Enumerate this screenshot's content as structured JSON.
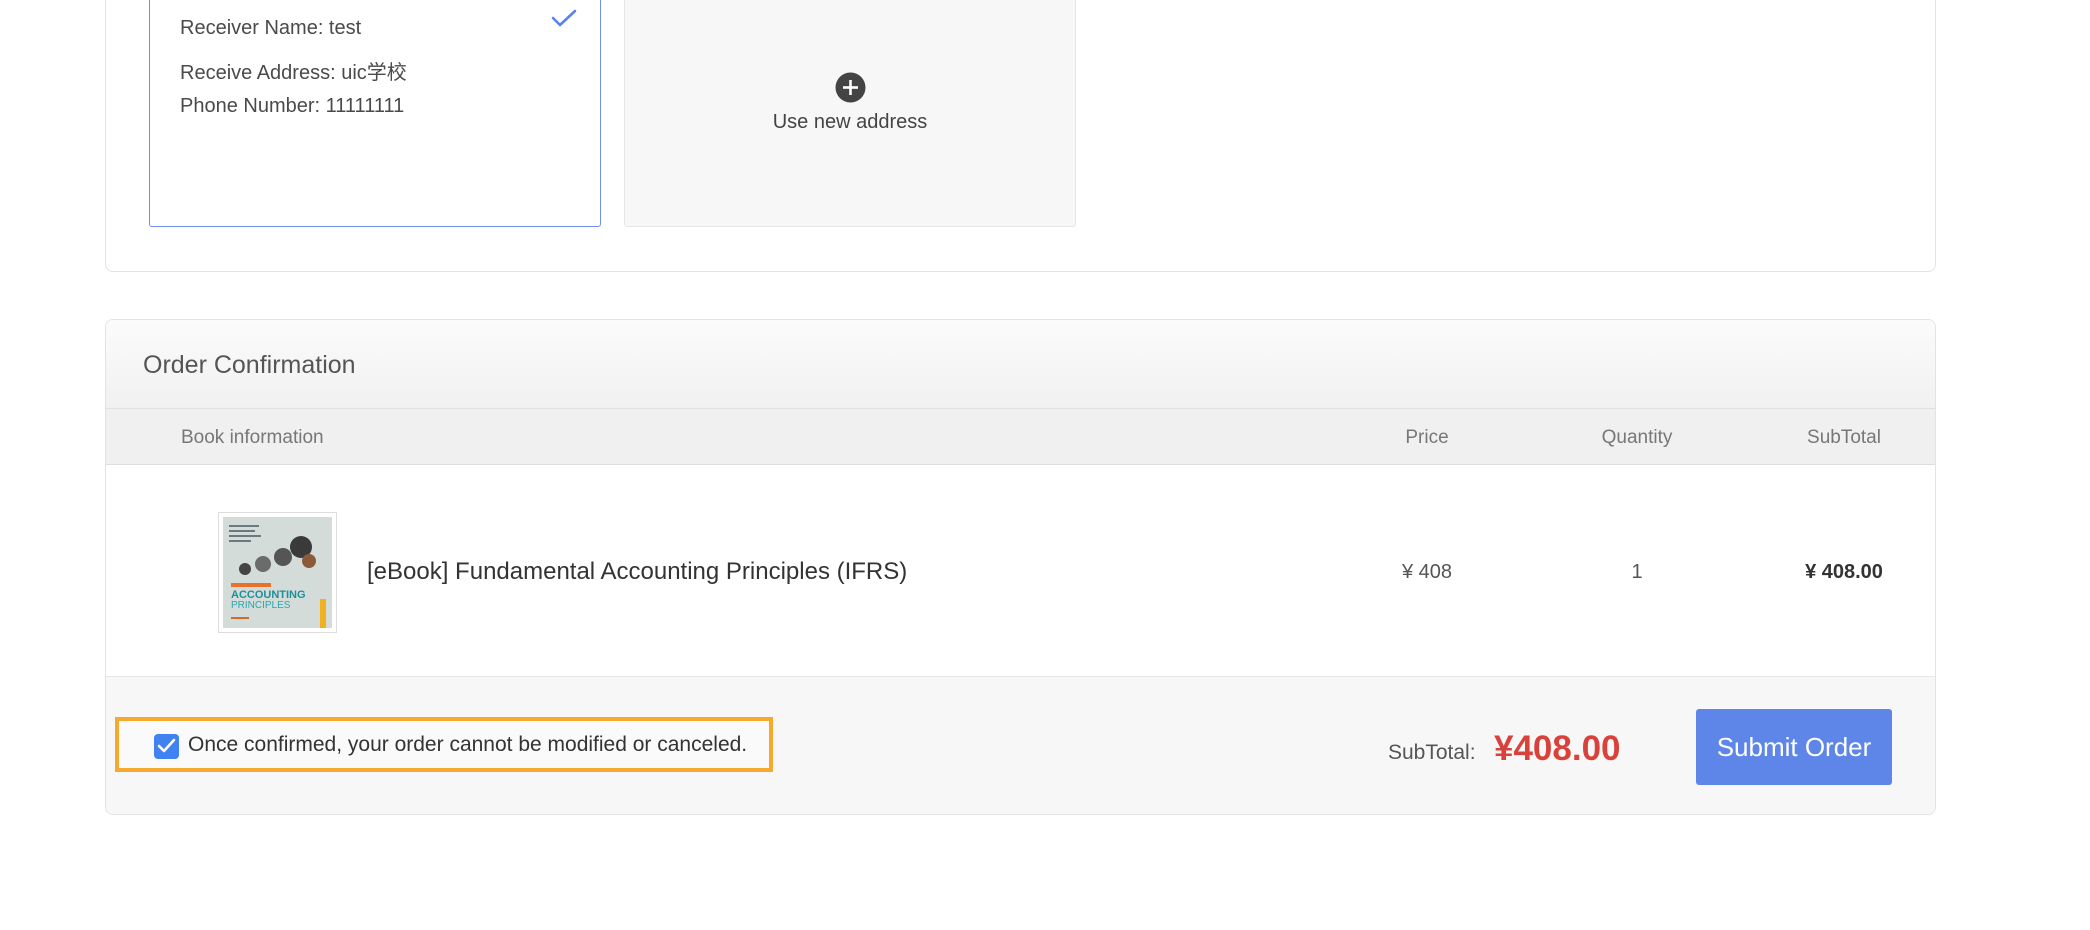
{
  "address": {
    "selected_card": {
      "receiver_name": "Receiver Name: test",
      "receive_address": "Receive Address: uic学校",
      "phone_number": "Phone Number: 11111111"
    },
    "new_address_label": "Use new address"
  },
  "order": {
    "title": "Order Confirmation",
    "columns": {
      "book_info": "Book information",
      "price": "Price",
      "quantity": "Quantity",
      "subtotal": "SubTotal"
    },
    "items": [
      {
        "title": "[eBook] Fundamental Accounting Principles (IFRS)",
        "price": "¥ 408",
        "quantity": "1",
        "subtotal": "¥ 408.00",
        "cover": {
          "title_line1": "ACCOUNTING",
          "title_line2": "PRINCIPLES"
        }
      }
    ],
    "confirm_checkbox": {
      "checked": true,
      "text": "Once confirmed, your order cannot be modified or canceled."
    },
    "footer": {
      "subtotal_label": "SubTotal:",
      "subtotal_value": "¥408.00",
      "submit_label": "Submit Order"
    }
  },
  "colors": {
    "accent_blue": "#5d86e8",
    "checkbox_blue": "#3f82f0",
    "price_red": "#d9423b",
    "highlight_orange": "#f5a92d"
  }
}
